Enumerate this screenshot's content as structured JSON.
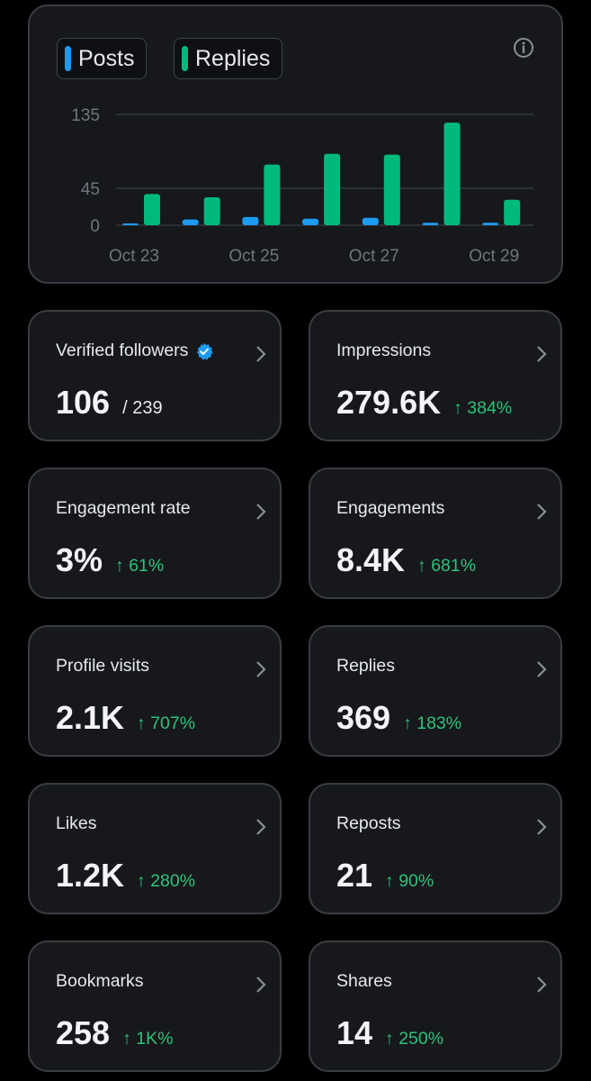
{
  "chart": {
    "legend": [
      {
        "label": "Posts",
        "color": "#1d9bf0"
      },
      {
        "label": "Replies",
        "color": "#00ba7c"
      }
    ],
    "info_icon": "info-icon"
  },
  "chart_data": {
    "type": "bar",
    "categories": [
      "Oct 23",
      "Oct 24",
      "Oct 25",
      "Oct 26",
      "Oct 27",
      "Oct 28",
      "Oct 29"
    ],
    "x_tick_labels": [
      "Oct 23",
      "Oct 25",
      "Oct 27",
      "Oct 29"
    ],
    "y_ticks": [
      0,
      45,
      135
    ],
    "ylim": [
      0,
      135
    ],
    "grid": true,
    "series": [
      {
        "name": "Posts",
        "color": "#1d9bf0",
        "values": [
          1,
          7,
          10,
          8,
          9,
          3,
          3
        ]
      },
      {
        "name": "Replies",
        "color": "#00ba7c",
        "values": [
          38,
          34,
          74,
          87,
          86,
          125,
          31
        ]
      }
    ]
  },
  "metrics": [
    {
      "title": "Verified followers",
      "verified": true,
      "value": "106",
      "sub": "/ 239",
      "change": ""
    },
    {
      "title": "Impressions",
      "value": "279.6K",
      "sub": "",
      "change": "↑ 384%"
    },
    {
      "title": "Engagement rate",
      "value": "3%",
      "sub": "",
      "change": "↑ 61%"
    },
    {
      "title": "Engagements",
      "value": "8.4K",
      "sub": "",
      "change": "↑ 681%"
    },
    {
      "title": "Profile visits",
      "value": "2.1K",
      "sub": "",
      "change": "↑ 707%"
    },
    {
      "title": "Replies",
      "value": "369",
      "sub": "",
      "change": "↑ 183%"
    },
    {
      "title": "Likes",
      "value": "1.2K",
      "sub": "",
      "change": "↑ 280%"
    },
    {
      "title": "Reposts",
      "value": "21",
      "sub": "",
      "change": "↑ 90%"
    },
    {
      "title": "Bookmarks",
      "value": "258",
      "sub": "",
      "change": "↑ 1K%"
    },
    {
      "title": "Shares",
      "value": "14",
      "sub": "",
      "change": "↑ 250%"
    }
  ],
  "colors": {
    "up": "#2fc27a",
    "verified": "#1d9bf0"
  }
}
